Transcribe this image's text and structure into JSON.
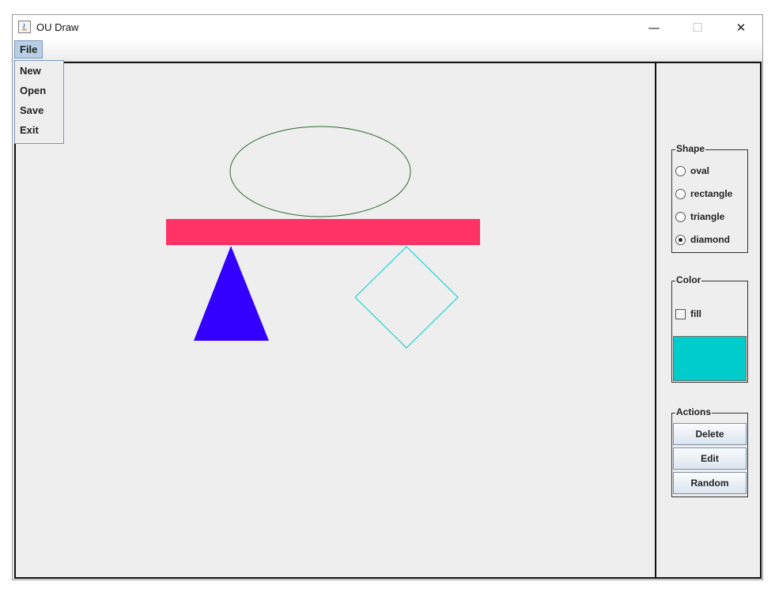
{
  "window": {
    "title": "OU Draw",
    "controls": {
      "minimize": "—",
      "maximize": "☐",
      "close": "✕"
    }
  },
  "menu": {
    "file_label": "File",
    "file_items": [
      "New",
      "Open",
      "Save",
      "Exit"
    ]
  },
  "canvas": {
    "shapes": [
      {
        "type": "oval",
        "filled": false,
        "color": "#2d6b2d"
      },
      {
        "type": "rectangle",
        "filled": true,
        "color": "#ff3366"
      },
      {
        "type": "triangle",
        "filled": true,
        "color": "#3300ff"
      },
      {
        "type": "diamond",
        "filled": false,
        "color": "#00cccc"
      }
    ]
  },
  "shape_panel": {
    "legend": "Shape",
    "options": [
      {
        "label": "oval",
        "selected": false
      },
      {
        "label": "rectangle",
        "selected": false
      },
      {
        "label": "triangle",
        "selected": false
      },
      {
        "label": "diamond",
        "selected": true
      }
    ]
  },
  "color_panel": {
    "legend": "Color",
    "fill_label": "fill",
    "fill_checked": false,
    "current_color": "#00cccc"
  },
  "actions_panel": {
    "legend": "Actions",
    "buttons": [
      "Delete",
      "Edit",
      "Random"
    ]
  }
}
